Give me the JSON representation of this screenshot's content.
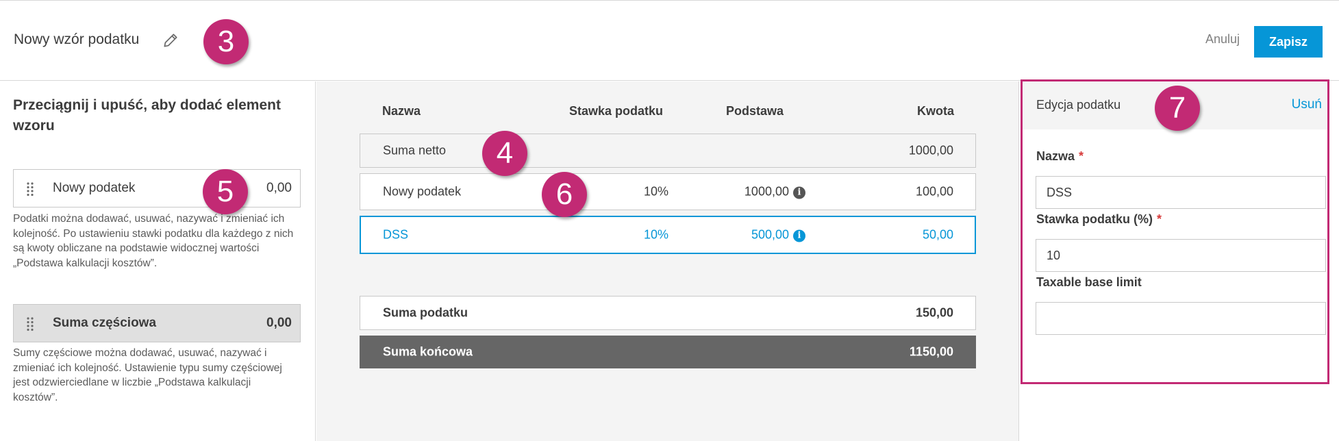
{
  "header": {
    "title": "Nowy wzór podatku",
    "cancel_label": "Anuluj",
    "save_label": "Zapisz"
  },
  "callouts": [
    "3",
    "4",
    "5",
    "6",
    "7"
  ],
  "left_panel": {
    "heading": "Przeciągnij i upuść, aby dodać element wzoru",
    "tax_item": {
      "label": "Nowy podatek",
      "value": "0,00"
    },
    "tax_help": "Podatki można dodawać, usuwać, nazywać i zmieniać ich kolejność. Po ustawieniu stawki podatku dla każdego z nich są kwoty obliczane na podstawie widocznej wartości „Podstawa kalkulacji kosztów”.",
    "subtotal_item": {
      "label": "Suma częściowa",
      "value": "0,00"
    },
    "subtotal_help": "Sumy częściowe można dodawać, usuwać, nazywać i zmieniać ich kolejność. Ustawienie typu sumy częściowej jest odzwierciedlane w liczbie „Podstawa kalkulacji kosztów”."
  },
  "table": {
    "headers": {
      "name": "Nazwa",
      "rate": "Stawka podatku",
      "base": "Podstawa",
      "amount": "Kwota"
    },
    "rows": [
      {
        "name": "Suma netto",
        "rate": "",
        "base": "",
        "amount": "1000,00"
      },
      {
        "name": "Nowy podatek",
        "rate": "10%",
        "base": "1000,00",
        "amount": "100,00"
      },
      {
        "name": "DSS",
        "rate": "10%",
        "base": "500,00",
        "amount": "50,00"
      }
    ],
    "tax_sum": {
      "name": "Suma podatku",
      "amount": "150,00"
    },
    "final_sum": {
      "name": "Suma końcowa",
      "amount": "1150,00"
    }
  },
  "editor": {
    "title": "Edycja podatku",
    "delete_label": "Usuń",
    "name_label": "Nazwa",
    "name_value": "DSS",
    "rate_label": "Stawka podatku (%)",
    "rate_value": "10",
    "limit_label": "Taxable base limit",
    "limit_value": "",
    "required_mark": "*"
  },
  "colors": {
    "accent": "#0696d7",
    "callout": "#c22a74",
    "dark_row": "#666666"
  },
  "icons": {
    "edit": "pencil-icon",
    "drag": "drag-handle-icon",
    "info": "info-icon"
  }
}
